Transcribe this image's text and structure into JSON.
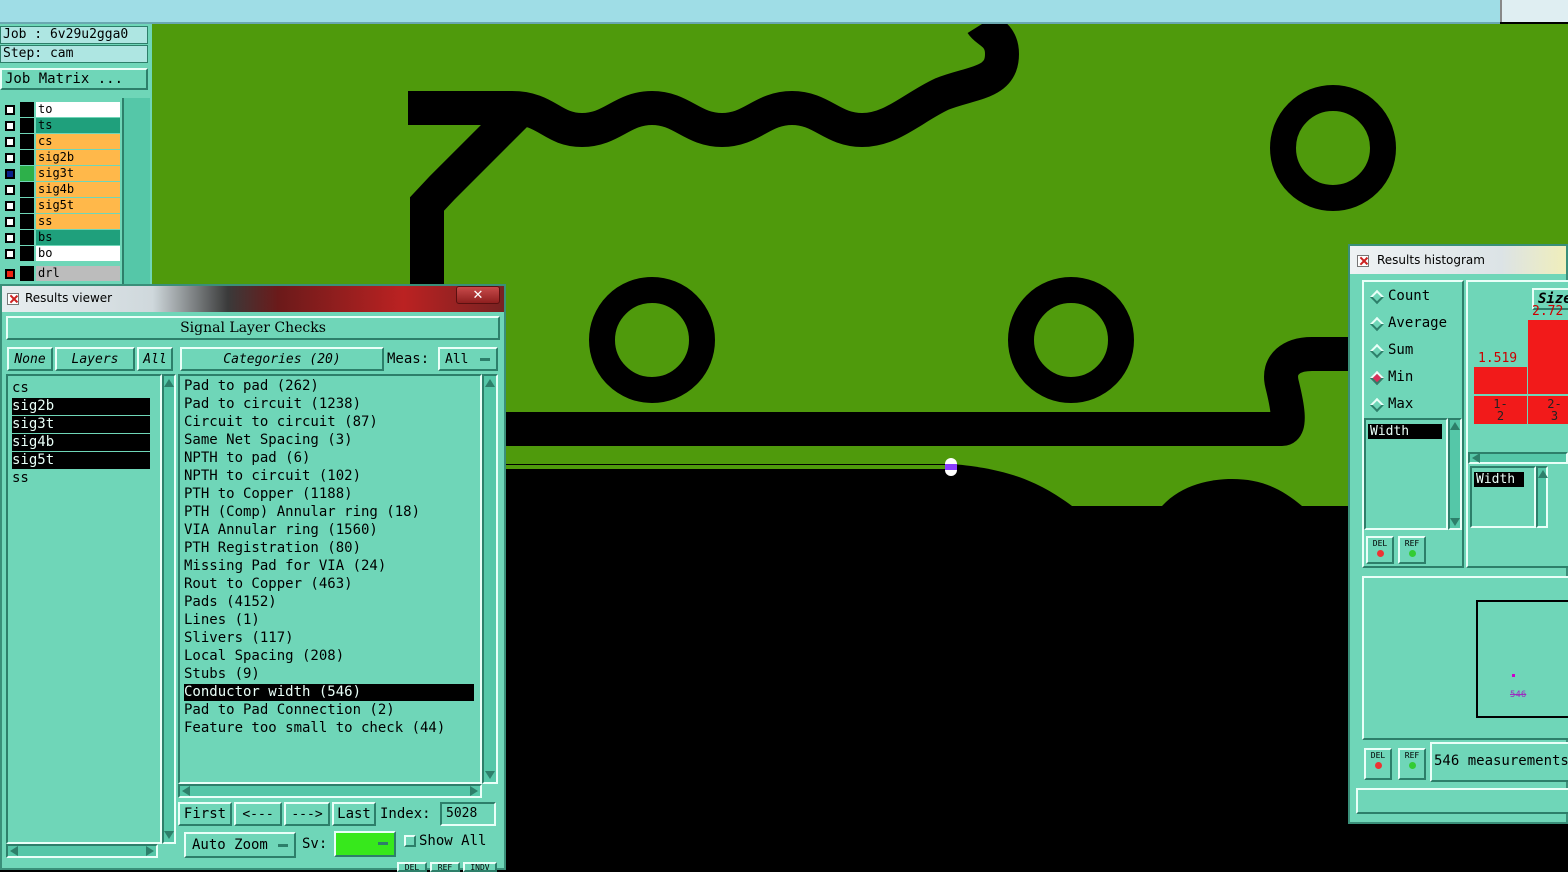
{
  "job_panel": {
    "job_label": "Job : 6v29u2gga0",
    "step_label": "Step: cam",
    "job_matrix_button": "Job Matrix ..."
  },
  "layers": [
    {
      "name": "to",
      "bg": "#ffffff",
      "checked": false
    },
    {
      "name": "ts",
      "bg": "#1fa07c",
      "checked": false
    },
    {
      "name": "cs",
      "bg": "#ffb84a",
      "checked": false
    },
    {
      "name": "sig2b",
      "bg": "#ffb84a",
      "checked": false
    },
    {
      "name": "sig3t",
      "bg": "#ffb84a",
      "checked": true
    },
    {
      "name": "sig4b",
      "bg": "#ffb84a",
      "checked": false
    },
    {
      "name": "sig5t",
      "bg": "#ffb84a",
      "checked": false
    },
    {
      "name": "ss",
      "bg": "#ffb84a",
      "checked": false
    },
    {
      "name": "bs",
      "bg": "#1fa07c",
      "checked": false
    },
    {
      "name": "bo",
      "bg": "#ffffff",
      "checked": false
    },
    {
      "name": "drl",
      "bg": "#bcbcbc",
      "checked": false
    }
  ],
  "results_viewer": {
    "window_title": "Results viewer",
    "close_symbol": "✕",
    "section_title": "Signal Layer Checks",
    "none_button": "None",
    "layers_button": "Layers",
    "all_button": "All",
    "categories_button": "Categories (20)",
    "meas_label": "Meas:",
    "meas_value": "All",
    "layer_items": [
      {
        "label": "cs",
        "selected": false
      },
      {
        "label": "sig2b",
        "selected": true
      },
      {
        "label": "sig3t",
        "selected": true
      },
      {
        "label": "sig4b",
        "selected": true
      },
      {
        "label": "sig5t",
        "selected": true
      },
      {
        "label": "ss",
        "selected": false
      }
    ],
    "categories": [
      {
        "label": "Pad to pad (262)",
        "selected": false
      },
      {
        "label": "Pad to circuit (1238)",
        "selected": false
      },
      {
        "label": "Circuit to circuit (87)",
        "selected": false
      },
      {
        "label": "Same Net Spacing (3)",
        "selected": false
      },
      {
        "label": "NPTH to pad (6)",
        "selected": false
      },
      {
        "label": "NPTH to circuit (102)",
        "selected": false
      },
      {
        "label": "PTH to Copper (1188)",
        "selected": false
      },
      {
        "label": "PTH (Comp) Annular ring (18)",
        "selected": false
      },
      {
        "label": "VIA Annular ring (1560)",
        "selected": false
      },
      {
        "label": "PTH Registration (80)",
        "selected": false
      },
      {
        "label": "Missing Pad for VIA (24)",
        "selected": false
      },
      {
        "label": "Rout to Copper (463)",
        "selected": false
      },
      {
        "label": "Pads (4152)",
        "selected": false
      },
      {
        "label": "Lines (1)",
        "selected": false
      },
      {
        "label": "Slivers (117)",
        "selected": false
      },
      {
        "label": "Local Spacing (208)",
        "selected": false
      },
      {
        "label": "Stubs (9)",
        "selected": false
      },
      {
        "label": "Conductor width (546)",
        "selected": true
      },
      {
        "label": "Pad to Pad Connection (2)",
        "selected": false
      },
      {
        "label": "Feature too small to check (44)",
        "selected": false
      }
    ],
    "nav": {
      "first": "First",
      "prev": "<---",
      "next": "--->",
      "last": "Last",
      "index_label": "Index:",
      "index_value": "5028"
    },
    "auto_zoom": "Auto Zoom",
    "sv_label": "Sv:",
    "show_all": "Show All",
    "bottom_buttons": [
      "DEL",
      "REF",
      "INDV"
    ]
  },
  "histogram": {
    "window_title": "Results histogram",
    "stats": [
      {
        "label": "Count",
        "on": false
      },
      {
        "label": "Average",
        "on": false
      },
      {
        "label": "Sum",
        "on": false
      },
      {
        "label": "Min",
        "on": true
      },
      {
        "label": "Max",
        "on": false
      }
    ],
    "measure_item": "Width",
    "measure_item2": "Width",
    "size_button": "Size",
    "del_label": "DEL",
    "ref_label": "REF",
    "bar_values": [
      "1.519",
      "2.72"
    ],
    "bar_heights": [
      1.519,
      2.72
    ],
    "bins": [
      "1-\n2",
      "2-\n3"
    ],
    "measurements_text": "546 measurements",
    "preview_label": "546"
  },
  "colors": {
    "panel": "#6fd6b8",
    "board_green": "#4f9a0c",
    "selection": "#000000",
    "hist_bar": "#f21a1a",
    "sv_swatch": "#37e81c"
  }
}
